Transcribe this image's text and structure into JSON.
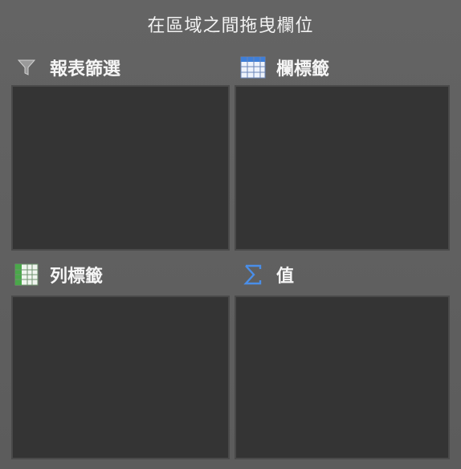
{
  "title": "在區域之間拖曳欄位",
  "areas": [
    {
      "label": "報表篩選",
      "icon": "filter-icon"
    },
    {
      "label": "欄標籤",
      "icon": "column-labels-icon"
    },
    {
      "label": "列標籤",
      "icon": "row-labels-icon"
    },
    {
      "label": "值",
      "icon": "sigma-icon"
    }
  ],
  "colors": {
    "panel": "#5f5f5f",
    "drop_zone": "#343434",
    "icon_blue": "#3f7fd8",
    "icon_green": "#4aa84a"
  }
}
